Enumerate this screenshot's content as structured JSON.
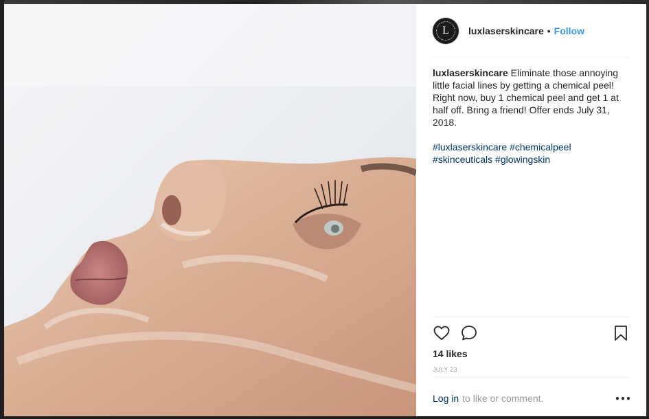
{
  "post": {
    "username": "luxlaserskincare",
    "separator": "•",
    "follow_label": "Follow",
    "avatar_letter": "L",
    "caption_user": "luxlaserskincare",
    "caption_text": "Eliminate those annoying little facial lines by getting a chemical peel! Right now, buy 1 chemical peel and get 1 at half off. Bring a friend! Offer ends July 31, 2018.",
    "hashtags": [
      "#luxlaserskincare",
      "#chemicalpeel",
      "#skinceuticals",
      "#glowingskin"
    ],
    "likes": "14 likes",
    "date": "JULY 23",
    "login_label": "Log in",
    "comment_prompt": "to like or comment."
  },
  "icons": {
    "like": "heart-icon",
    "comment": "comment-icon",
    "save": "bookmark-icon",
    "more": "more-options-icon"
  },
  "colors": {
    "follow": "#3897f0",
    "link": "#003569",
    "text": "#262626",
    "muted": "#999999"
  }
}
